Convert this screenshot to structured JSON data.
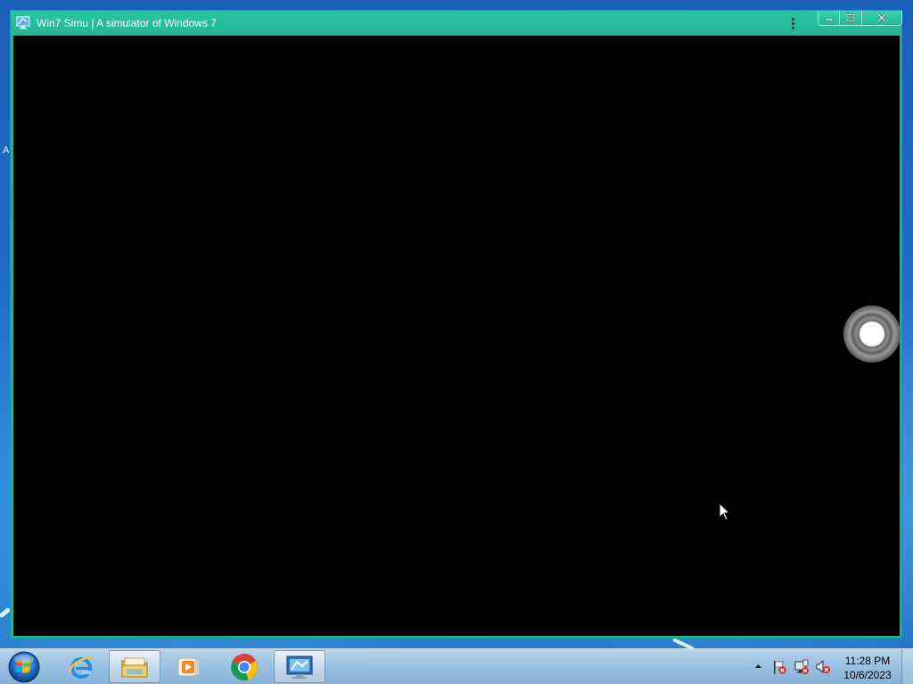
{
  "desktop": {
    "edge_letter": "A"
  },
  "window": {
    "title": "Win7 Simu | A simulator of Windows 7",
    "icon": "app-monitor-icon",
    "menu_icon": "kebab-menu-icon",
    "controls": {
      "minimize_icon": "minimize-icon",
      "maximize_icon": "maximize-icon",
      "close_icon": "close-icon"
    },
    "accent_color": "#1db394",
    "content_color": "#000000"
  },
  "overlay": {
    "floating_button_icon": "assistive-touch-icon",
    "cursor_icon": "mouse-pointer-icon"
  },
  "taskbar": {
    "start_icon": "windows-start-orb-icon",
    "pinned": [
      {
        "name": "internet-explorer",
        "icon": "internet-explorer-icon",
        "active": false
      },
      {
        "name": "windows-explorer",
        "icon": "folder-library-icon",
        "active": true
      },
      {
        "name": "media-player",
        "icon": "media-player-icon",
        "active": false
      },
      {
        "name": "google-chrome",
        "icon": "chrome-icon",
        "active": false
      },
      {
        "name": "remote-desktop",
        "icon": "remote-desktop-icon",
        "active": true
      }
    ],
    "tray": {
      "expand_icon": "chevron-up-icon",
      "icons": [
        "action-center-flag-icon",
        "network-disconnected-icon",
        "volume-muted-icon"
      ]
    },
    "clock": {
      "time": "11:28 PM",
      "date": "10/6/2023"
    }
  }
}
